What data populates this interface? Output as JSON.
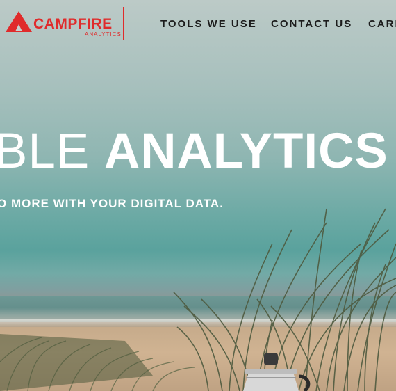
{
  "brand": {
    "name": "CAMPFIRE",
    "sub": "ANALYTICS",
    "color": "#e02b2b"
  },
  "nav": {
    "items": [
      {
        "label": "TOOLS WE USE"
      },
      {
        "label": "CONTACT US"
      },
      {
        "label": "CARE"
      }
    ]
  },
  "hero": {
    "headline_light": "BLE ",
    "headline_bold": "ANALYTICS",
    "subline": "O MORE WITH YOUR DIGITAL DATA."
  }
}
